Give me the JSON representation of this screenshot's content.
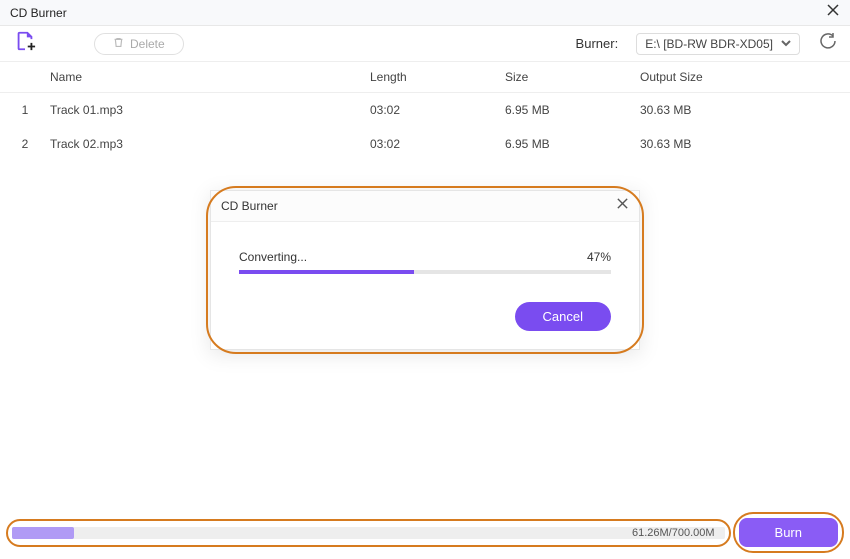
{
  "window": {
    "title": "CD Burner"
  },
  "toolbar": {
    "delete_label": "Delete",
    "burner_label": "Burner:",
    "burner_value": "E:\\ [BD-RW  BDR-XD05]"
  },
  "table": {
    "headers": {
      "name": "Name",
      "length": "Length",
      "size": "Size",
      "output": "Output Size"
    },
    "rows": [
      {
        "idx": "1",
        "name": "Track 01.mp3",
        "length": "03:02",
        "size": "6.95 MB",
        "output": "30.63 MB"
      },
      {
        "idx": "2",
        "name": "Track 02.mp3",
        "length": "03:02",
        "size": "6.95 MB",
        "output": "30.63 MB"
      }
    ]
  },
  "dialog": {
    "title": "CD Burner",
    "status": "Converting...",
    "percent": "47%",
    "percent_num": 47,
    "cancel_label": "Cancel"
  },
  "bottom": {
    "capacity_text": "61.26M/700.00M",
    "capacity_pct": 8.75,
    "burn_label": "Burn"
  }
}
